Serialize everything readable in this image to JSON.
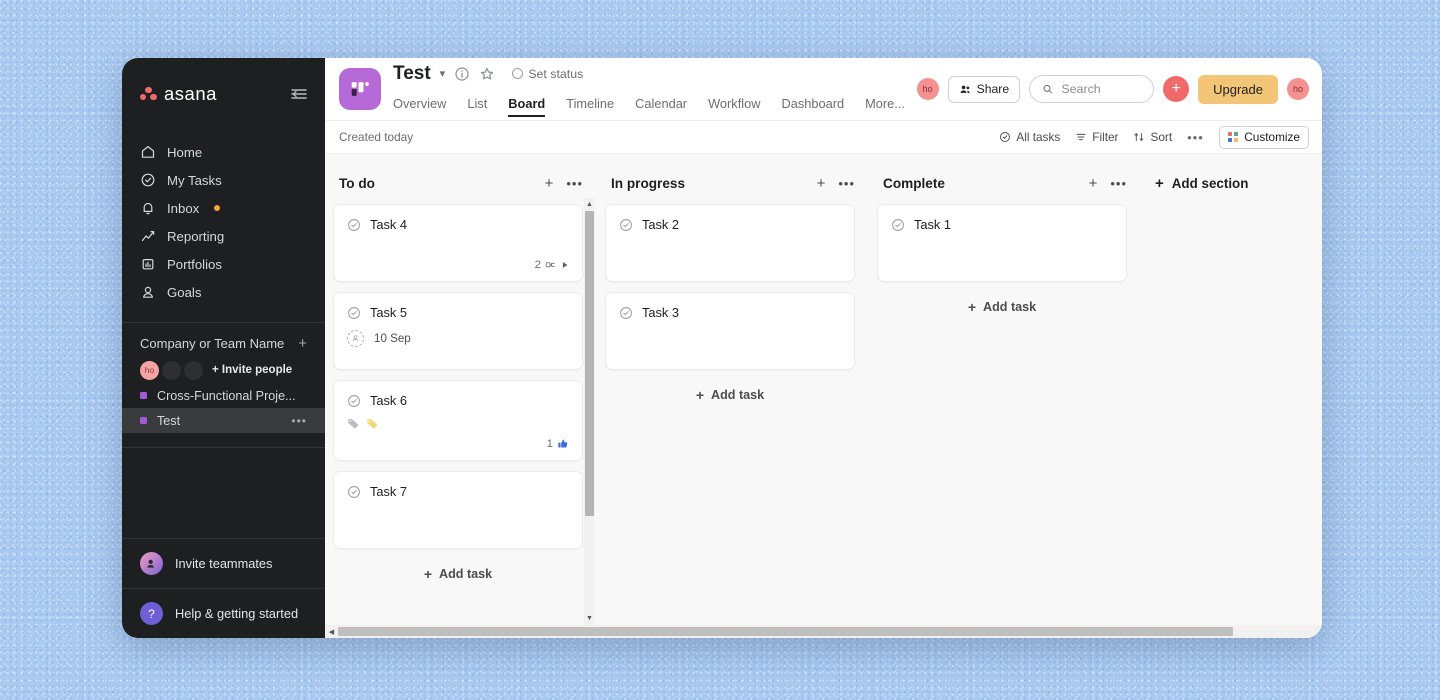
{
  "sidebar": {
    "logo_text": "asana",
    "collapse_icon": "collapse-sidebar-icon",
    "nav": [
      {
        "label": "Home",
        "icon": "home-icon"
      },
      {
        "label": "My Tasks",
        "icon": "check-circle-icon"
      },
      {
        "label": "Inbox",
        "icon": "bell-icon",
        "badge": true
      },
      {
        "label": "Reporting",
        "icon": "chart-line-icon"
      },
      {
        "label": "Portfolios",
        "icon": "briefcase-chart-icon"
      },
      {
        "label": "Goals",
        "icon": "target-person-icon"
      }
    ],
    "team_header": "Company or Team Name",
    "team_add_icon": "plus-icon",
    "member_initials": "ho",
    "invite_people": "+ Invite people",
    "projects": [
      {
        "label": "Cross-Functional Proje...",
        "color": "#a35ad6",
        "active": false
      },
      {
        "label": "Test",
        "color": "#a35ad6",
        "active": true
      }
    ],
    "bottom": [
      {
        "label": "Invite teammates",
        "icon": "invite-teammates-icon"
      },
      {
        "label": "Help & getting started",
        "icon": "help-question-icon"
      }
    ]
  },
  "header": {
    "project_icon": "board-project-icon",
    "project_title": "Test",
    "chevron_icon": "chevron-down-icon",
    "info_icon": "info-circle-icon",
    "star_icon": "star-outline-icon",
    "set_status": "Set status",
    "tabs": [
      {
        "label": "Overview",
        "active": false
      },
      {
        "label": "List",
        "active": false
      },
      {
        "label": "Board",
        "active": true
      },
      {
        "label": "Timeline",
        "active": false
      },
      {
        "label": "Calendar",
        "active": false
      },
      {
        "label": "Workflow",
        "active": false
      },
      {
        "label": "Dashboard",
        "active": false
      },
      {
        "label": "More...",
        "active": false
      }
    ],
    "avatar_initials": "ho",
    "share_label": "Share",
    "share_icon": "people-icon",
    "search_placeholder": "Search",
    "search_value": "",
    "search_icon": "search-icon",
    "add_icon": "plus-icon",
    "upgrade_label": "Upgrade",
    "account_initials": "ho"
  },
  "toolbar": {
    "created": "Created today",
    "all_tasks": "All tasks",
    "all_tasks_icon": "check-circle-icon",
    "filter": "Filter",
    "filter_icon": "filter-icon",
    "sort": "Sort",
    "sort_icon": "sort-arrows-icon",
    "more_icon": "ellipsis-icon",
    "customize": "Customize",
    "customize_icon": "customize-grid-icon"
  },
  "board": {
    "add_section_label": "Add section",
    "add_task_label": "Add task",
    "columns": [
      {
        "title": "To do",
        "add_task": "Add task",
        "cards": [
          {
            "title": "Task 4",
            "subtask_count": "2",
            "subtask_icon": "subtask-icon",
            "expand_icon": "expand-triangle-icon"
          },
          {
            "title": "Task 5",
            "assignee_icon": "assignee-placeholder-icon",
            "due_date": "10 Sep"
          },
          {
            "title": "Task 6",
            "tags": [
              "#b9bcc0",
              "#f1d873"
            ],
            "like_count": "1",
            "like_icon": "thumbs-up-icon"
          },
          {
            "title": "Task 7"
          }
        ]
      },
      {
        "title": "In progress",
        "add_task": "Add task",
        "cards": [
          {
            "title": "Task 2"
          },
          {
            "title": "Task 3"
          }
        ]
      },
      {
        "title": "Complete",
        "add_task": "Add task",
        "cards": [
          {
            "title": "Task 1"
          }
        ]
      }
    ]
  },
  "colors": {
    "asana_red": "#f06a6a",
    "upgrade_amber": "#f3c577",
    "project_purple": "#a35ad6",
    "sidebar_bg": "#1e1f21",
    "board_bg": "#f9f8f8",
    "tag_gray": "#b9bcc0",
    "tag_yellow": "#f1d873",
    "like_blue": "#3f6ad8"
  }
}
